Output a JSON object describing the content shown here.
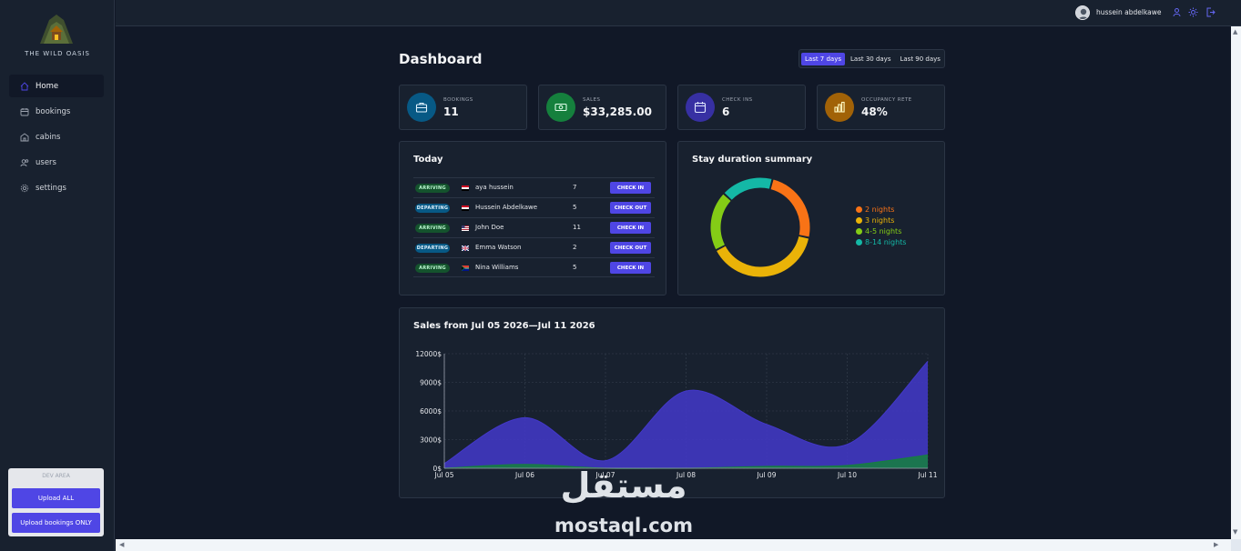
{
  "app": {
    "logo_text": "THE WILD OASIS"
  },
  "sidebar": {
    "items": [
      {
        "label": "Home",
        "icon": "home-icon",
        "active": true
      },
      {
        "label": "bookings",
        "icon": "calendar-icon",
        "active": false
      },
      {
        "label": "cabins",
        "icon": "cabin-icon",
        "active": false
      },
      {
        "label": "users",
        "icon": "users-icon",
        "active": false
      },
      {
        "label": "settings",
        "icon": "gear-icon",
        "active": false
      }
    ],
    "uploader": {
      "title": "DEV AREA",
      "upload_all": "Upload ALL",
      "upload_bookings": "Upload bookings ONLY"
    }
  },
  "header": {
    "username": "hussein abdelkawe",
    "icons": [
      "user-icon",
      "sun-icon",
      "logout-icon"
    ]
  },
  "dashboard": {
    "title": "Dashboard",
    "filters": [
      {
        "label": "Last 7 days",
        "active": true
      },
      {
        "label": "Last 30 days",
        "active": false
      },
      {
        "label": "Last 90 days",
        "active": false
      }
    ],
    "stats": [
      {
        "label": "BOOKINGS",
        "value": "11",
        "color": "#075985",
        "icon": "briefcase-icon"
      },
      {
        "label": "SALES",
        "value": "$33,285.00",
        "color": "#15803d",
        "icon": "banknotes-icon"
      },
      {
        "label": "CHECK INS",
        "value": "6",
        "color": "#3730a3",
        "icon": "calendar-days-icon"
      },
      {
        "label": "OCCUPANCY RETE",
        "value": "48%",
        "color": "#a16207",
        "icon": "chart-bar-icon"
      }
    ],
    "today": {
      "title": "Today",
      "rows": [
        {
          "status": "ARRIVING",
          "guest": "aya hussein",
          "nights": "7",
          "action": "CHECK IN",
          "flag": "eg"
        },
        {
          "status": "DEPARTING",
          "guest": "Hussein Abdelkawe",
          "nights": "5",
          "action": "CHECK OUT",
          "flag": "eg"
        },
        {
          "status": "ARRIVING",
          "guest": "John Doe",
          "nights": "11",
          "action": "CHECK IN",
          "flag": "us"
        },
        {
          "status": "DEPARTING",
          "guest": "Emma Watson",
          "nights": "2",
          "action": "CHECK OUT",
          "flag": "gb"
        },
        {
          "status": "ARRIVING",
          "guest": "Nina Williams",
          "nights": "5",
          "action": "CHECK IN",
          "flag": "za"
        }
      ]
    },
    "duration": {
      "title": "Stay duration summary"
    },
    "sales": {
      "title": "Sales from Jul 05 2026—Jul 11 2026"
    }
  },
  "chart_data": [
    {
      "type": "pie",
      "title": "Stay duration summary",
      "categories": [
        "2 nights",
        "3 nights",
        "4-5 nights",
        "8-14 nights"
      ],
      "values": [
        1,
        1.6,
        0.8,
        0.7
      ],
      "colors": [
        "#f97316",
        "#eab308",
        "#84cc16",
        "#14b8a6"
      ],
      "donut": true,
      "legend": "right"
    },
    {
      "type": "area",
      "title": "Sales from Jul 05 2026—Jul 11 2026",
      "categories": [
        "Jul 05",
        "Jul 06",
        "Jul 07",
        "Jul 08",
        "Jul 09",
        "Jul 10",
        "Jul 11"
      ],
      "series": [
        {
          "values": [
            500,
            5300,
            800,
            8100,
            4600,
            2500,
            11200
          ],
          "color": "#4338ca"
        },
        {
          "values": [
            0,
            400,
            0,
            0,
            200,
            300,
            1400
          ],
          "color": "#15803d"
        }
      ],
      "y_ticks": [
        "0$",
        "3000$",
        "6000$",
        "9000$",
        "12000$"
      ],
      "ylim": [
        0,
        12000
      ],
      "grid": true
    }
  ],
  "watermark": {
    "big": "مستقل",
    "small": "mostaql.com"
  }
}
